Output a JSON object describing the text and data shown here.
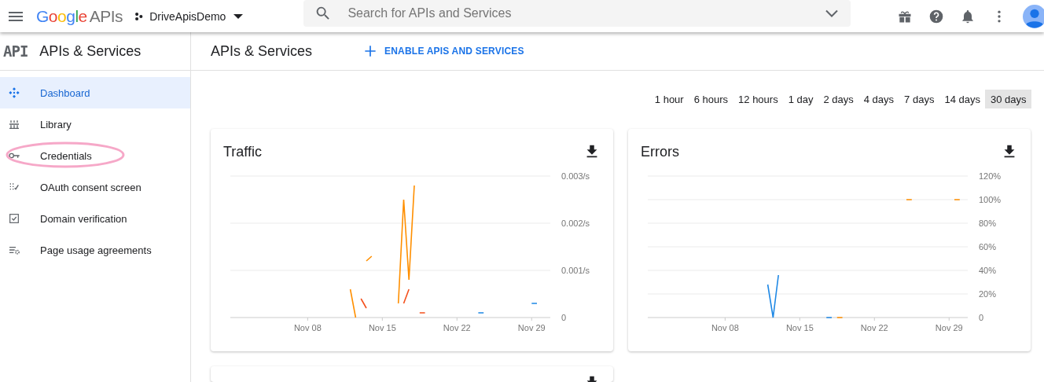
{
  "header": {
    "logo": {
      "brand": "Google",
      "product": "APIs"
    },
    "project": "DriveApisDemo",
    "search": {
      "placeholder": "Search for APIs and Services"
    }
  },
  "sidebar": {
    "logo_text": "API",
    "title": "APIs & Services",
    "items": [
      {
        "kind": "dashboard",
        "label": "Dashboard",
        "selected": true,
        "circled": false
      },
      {
        "kind": "library",
        "label": "Library",
        "selected": false,
        "circled": false
      },
      {
        "kind": "key",
        "label": "Credentials",
        "selected": false,
        "circled": true
      },
      {
        "kind": "consent",
        "label": "OAuth consent screen",
        "selected": false,
        "circled": false
      },
      {
        "kind": "verify",
        "label": "Domain verification",
        "selected": false,
        "circled": false
      },
      {
        "kind": "agreements",
        "label": "Page usage agreements",
        "selected": false,
        "circled": false
      }
    ]
  },
  "main": {
    "title": "APIs & Services",
    "action": "ENABLE APIS AND SERVICES",
    "time_ranges": [
      {
        "label": "1 hour",
        "selected": false
      },
      {
        "label": "6 hours",
        "selected": false
      },
      {
        "label": "12 hours",
        "selected": false
      },
      {
        "label": "1 day",
        "selected": false
      },
      {
        "label": "2 days",
        "selected": false
      },
      {
        "label": "4 days",
        "selected": false
      },
      {
        "label": "7 days",
        "selected": false
      },
      {
        "label": "14 days",
        "selected": false
      },
      {
        "label": "30 days",
        "selected": true
      }
    ],
    "cards": [
      {
        "kind": "chart",
        "title": "Traffic",
        "chart_data": {
          "type": "line",
          "grid": true,
          "categories": [
            null,
            null,
            null,
            null,
            null,
            null,
            null,
            null,
            null,
            null,
            null,
            null,
            null,
            null,
            "Nov 08",
            null,
            null,
            null,
            null,
            null,
            null,
            null,
            null,
            null,
            null,
            null,
            null,
            null,
            "Nov 15",
            null,
            null,
            null,
            null,
            null,
            null,
            null,
            null,
            null,
            null,
            null,
            null,
            null,
            "Nov 22",
            null,
            null,
            null,
            null,
            null,
            null,
            null,
            null,
            null,
            null,
            null,
            null,
            null,
            "Nov 29",
            null,
            null,
            null
          ],
          "ylim": [
            0,
            0.003
          ],
          "yticks": [
            {
              "value": 0,
              "label": "0"
            },
            {
              "value": 0.001,
              "label": "0.001/s"
            },
            {
              "value": 0.002,
              "label": "0.002/s"
            },
            {
              "value": 0.003,
              "label": "0.003/s"
            }
          ],
          "series": [
            {
              "color": "#ff8f00",
              "values": [
                null,
                null,
                null,
                null,
                null,
                null,
                null,
                null,
                null,
                null,
                null,
                null,
                null,
                null,
                null,
                null,
                null,
                null,
                null,
                null,
                null,
                null,
                0.0006,
                0,
                null,
                0.0012,
                0.0013,
                null,
                null,
                null,
                null,
                0.0003,
                0.0025,
                0.0008,
                0.0028,
                null,
                null,
                null,
                null,
                null,
                null,
                null,
                null,
                null,
                null,
                null,
                null,
                null,
                null,
                null,
                null,
                null,
                null,
                null,
                null,
                null,
                null,
                null,
                null,
                null
              ]
            },
            {
              "color": "#f4511e",
              "values": [
                null,
                null,
                null,
                null,
                null,
                null,
                null,
                null,
                null,
                null,
                null,
                null,
                null,
                null,
                null,
                null,
                null,
                null,
                null,
                null,
                null,
                null,
                null,
                null,
                0.0004,
                0.0002,
                null,
                null,
                null,
                null,
                null,
                null,
                0.0003,
                0.0006,
                null,
                0.0001,
                0.0001,
                null,
                null,
                null,
                null,
                null,
                null,
                null,
                null,
                null,
                null,
                null,
                null,
                null,
                null,
                null,
                null,
                null,
                null,
                null,
                null,
                null,
                null,
                null
              ]
            },
            {
              "color": "#1e88e5",
              "values": [
                null,
                null,
                null,
                null,
                null,
                null,
                null,
                null,
                null,
                null,
                null,
                null,
                null,
                null,
                null,
                null,
                null,
                null,
                null,
                null,
                null,
                null,
                null,
                null,
                null,
                null,
                null,
                null,
                null,
                null,
                null,
                null,
                null,
                null,
                null,
                null,
                null,
                null,
                null,
                null,
                null,
                null,
                null,
                null,
                null,
                null,
                0.0001,
                0.0001,
                null,
                null,
                null,
                null,
                null,
                null,
                null,
                null,
                0.0003,
                0.0003,
                null,
                null
              ]
            }
          ]
        }
      },
      {
        "kind": "chart",
        "title": "Errors",
        "chart_data": {
          "type": "line",
          "grid": true,
          "categories": [
            null,
            null,
            null,
            null,
            null,
            null,
            null,
            null,
            null,
            null,
            null,
            null,
            null,
            null,
            "Nov 08",
            null,
            null,
            null,
            null,
            null,
            null,
            null,
            null,
            null,
            null,
            null,
            null,
            null,
            "Nov 15",
            null,
            null,
            null,
            null,
            null,
            null,
            null,
            null,
            null,
            null,
            null,
            null,
            null,
            "Nov 22",
            null,
            null,
            null,
            null,
            null,
            null,
            null,
            null,
            null,
            null,
            null,
            null,
            null,
            "Nov 29",
            null,
            null,
            null
          ],
          "ylim": [
            0,
            120
          ],
          "yticks": [
            {
              "value": 0,
              "label": "0"
            },
            {
              "value": 20,
              "label": "20%"
            },
            {
              "value": 40,
              "label": "40%"
            },
            {
              "value": 60,
              "label": "60%"
            },
            {
              "value": 80,
              "label": "80%"
            },
            {
              "value": 100,
              "label": "100%"
            },
            {
              "value": 120,
              "label": "120%"
            }
          ],
          "series": [
            {
              "color": "#1e88e5",
              "values": [
                null,
                null,
                null,
                null,
                null,
                null,
                null,
                null,
                null,
                null,
                null,
                null,
                null,
                null,
                null,
                null,
                null,
                null,
                null,
                null,
                null,
                null,
                28,
                0,
                36,
                null,
                null,
                null,
                null,
                null,
                null,
                null,
                null,
                0,
                0,
                null,
                null,
                null,
                null,
                null,
                null,
                null,
                null,
                null,
                null,
                null,
                null,
                null,
                null,
                null,
                null,
                null,
                null,
                null,
                null,
                null,
                null,
                null,
                null,
                null
              ]
            },
            {
              "color": "#ff8f00",
              "values": [
                null,
                null,
                null,
                null,
                null,
                null,
                null,
                null,
                null,
                null,
                null,
                null,
                null,
                null,
                null,
                null,
                null,
                null,
                null,
                null,
                null,
                null,
                null,
                null,
                null,
                null,
                null,
                null,
                null,
                null,
                null,
                null,
                null,
                null,
                null,
                0,
                0,
                null,
                null,
                null,
                null,
                null,
                null,
                null,
                null,
                null,
                null,
                null,
                100,
                100,
                null,
                null,
                null,
                null,
                null,
                null,
                null,
                100,
                100,
                null
              ]
            }
          ]
        }
      },
      {
        "kind": "placeholder"
      }
    ]
  }
}
